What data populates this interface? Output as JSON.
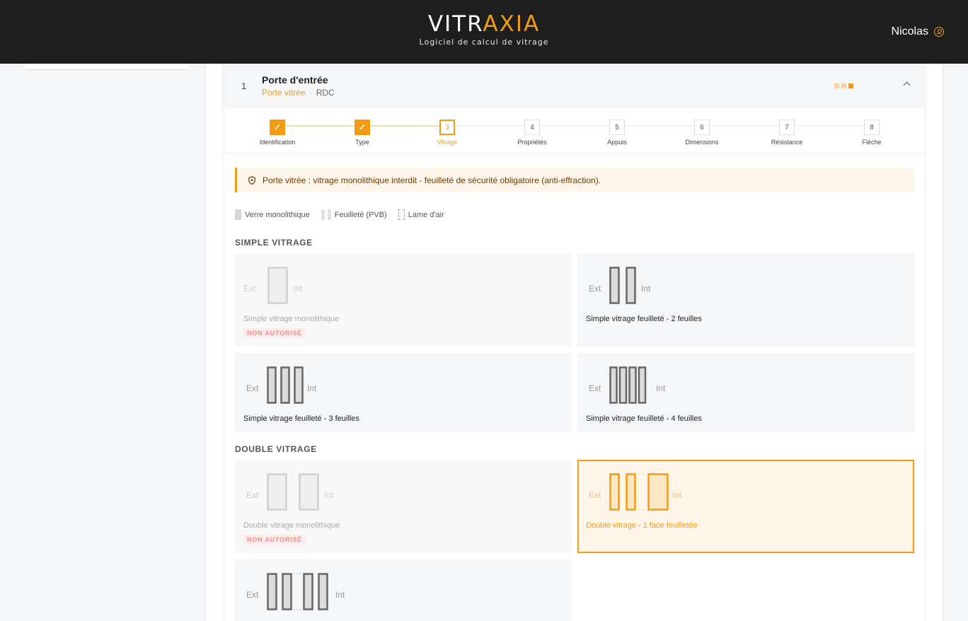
{
  "header": {
    "brand_main": "VITR",
    "brand_accent": "AXIA",
    "tagline": "Logiciel de calcul de vitrage",
    "user_name": "Nicolas"
  },
  "item": {
    "number": "1",
    "title": "Porte d'entrée",
    "type": "Porte vitrée",
    "separator": "·",
    "level": "RDC"
  },
  "stepper": [
    {
      "num": "✓",
      "label": "Identification",
      "state": "done"
    },
    {
      "num": "✓",
      "label": "Type",
      "state": "done"
    },
    {
      "num": "3",
      "label": "Vitrage",
      "state": "current"
    },
    {
      "num": "4",
      "label": "Propriétés",
      "state": "todo"
    },
    {
      "num": "5",
      "label": "Appuis",
      "state": "todo"
    },
    {
      "num": "6",
      "label": "Dimensions",
      "state": "todo"
    },
    {
      "num": "7",
      "label": "Résistance",
      "state": "todo"
    },
    {
      "num": "8",
      "label": "Flèche",
      "state": "todo"
    }
  ],
  "alert": {
    "text": "Porte vitrée : vitrage monolithique interdit - feuilleté de sécurité obligatoire (anti-effraction)."
  },
  "legend": {
    "mono": "Verre monolithique",
    "pvb": "Feuilleté (PVB)",
    "air": "Lame d'air"
  },
  "sections": {
    "simple": "SIMPLE VITRAGE",
    "double": "DOUBLE VITRAGE"
  },
  "options": {
    "ext": "Ext",
    "int": "Int",
    "not_allowed": "NON AUTORISÉ",
    "sv_mono": "Simple vitrage monolithique",
    "sv_f2": "Simple vitrage feuilleté - 2 feuilles",
    "sv_f3": "Simple vitrage feuilleté - 3 feuilles",
    "sv_f4": "Simple vitrage feuilleté - 4 feuilles",
    "dv_mono": "Double vitrage monolithique",
    "dv_1f": "Double vitrage - 1 face feuilletée"
  },
  "colors": {
    "accent": "#f39c12",
    "header_bg": "#1e1e1e",
    "danger": "#f08c8c"
  }
}
